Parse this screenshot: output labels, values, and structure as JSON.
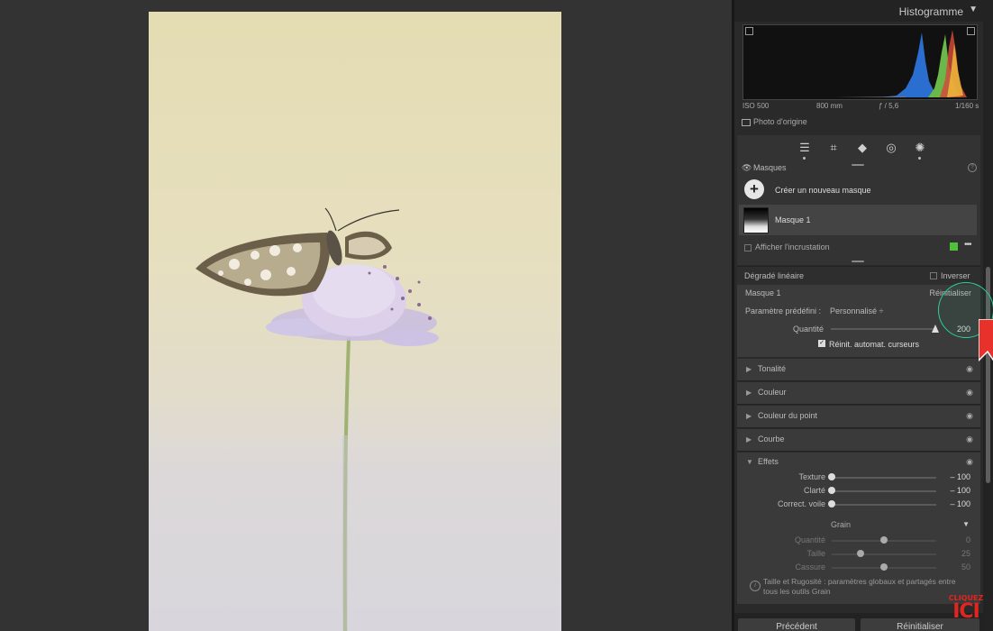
{
  "histogram": {
    "title": "Histogramme",
    "iso": "ISO 500",
    "focal": "800 mm",
    "aperture": "ƒ / 5,6",
    "shutter": "1/160 s",
    "original_photo": "Photo d'origine"
  },
  "masks": {
    "title": "Masques",
    "create_label": "Créer un nouveau masque",
    "mask_name": "Masque 1",
    "overlay_label": "Afficher l'incrustation",
    "overlay_color": "#4ec33a"
  },
  "gradient": {
    "title": "Dégradé linéaire",
    "invert_label": "Inverser"
  },
  "mask_panel": {
    "title": "Masque 1",
    "reset_label": "Réinitialiser",
    "preset_label": "Paramètre prédéfini :",
    "preset_value": "Personnalisé ÷",
    "amount_label": "Quantité",
    "amount_value": "200",
    "amount_fraction": 1.0,
    "auto_reset_label": "Réinit. automat. curseurs"
  },
  "sections": [
    {
      "label": "Tonalité"
    },
    {
      "label": "Couleur"
    },
    {
      "label": "Couleur du point"
    },
    {
      "label": "Courbe"
    }
  ],
  "effects": {
    "title": "Effets",
    "sliders": [
      {
        "label": "Texture",
        "value": "– 100",
        "fraction": 0.0
      },
      {
        "label": "Clarté",
        "value": "– 100",
        "fraction": 0.0
      },
      {
        "label": "Correct. voile",
        "value": "– 100",
        "fraction": 0.0
      }
    ],
    "grain_label": "Grain",
    "grain_sliders": [
      {
        "label": "Quantité",
        "value": "0",
        "fraction": 0.5
      },
      {
        "label": "Taille",
        "value": "25",
        "fraction": 0.28
      },
      {
        "label": "Cassure",
        "value": "50",
        "fraction": 0.5
      }
    ],
    "info_text": "Taille et Rugosité : paramètres globaux et partagés entre tous les outils Grain"
  },
  "bottom": {
    "previous": "Précédent",
    "reset": "Réinitialiser"
  },
  "watermark": {
    "small": "CLIQUEZ",
    "big": "ICI"
  }
}
